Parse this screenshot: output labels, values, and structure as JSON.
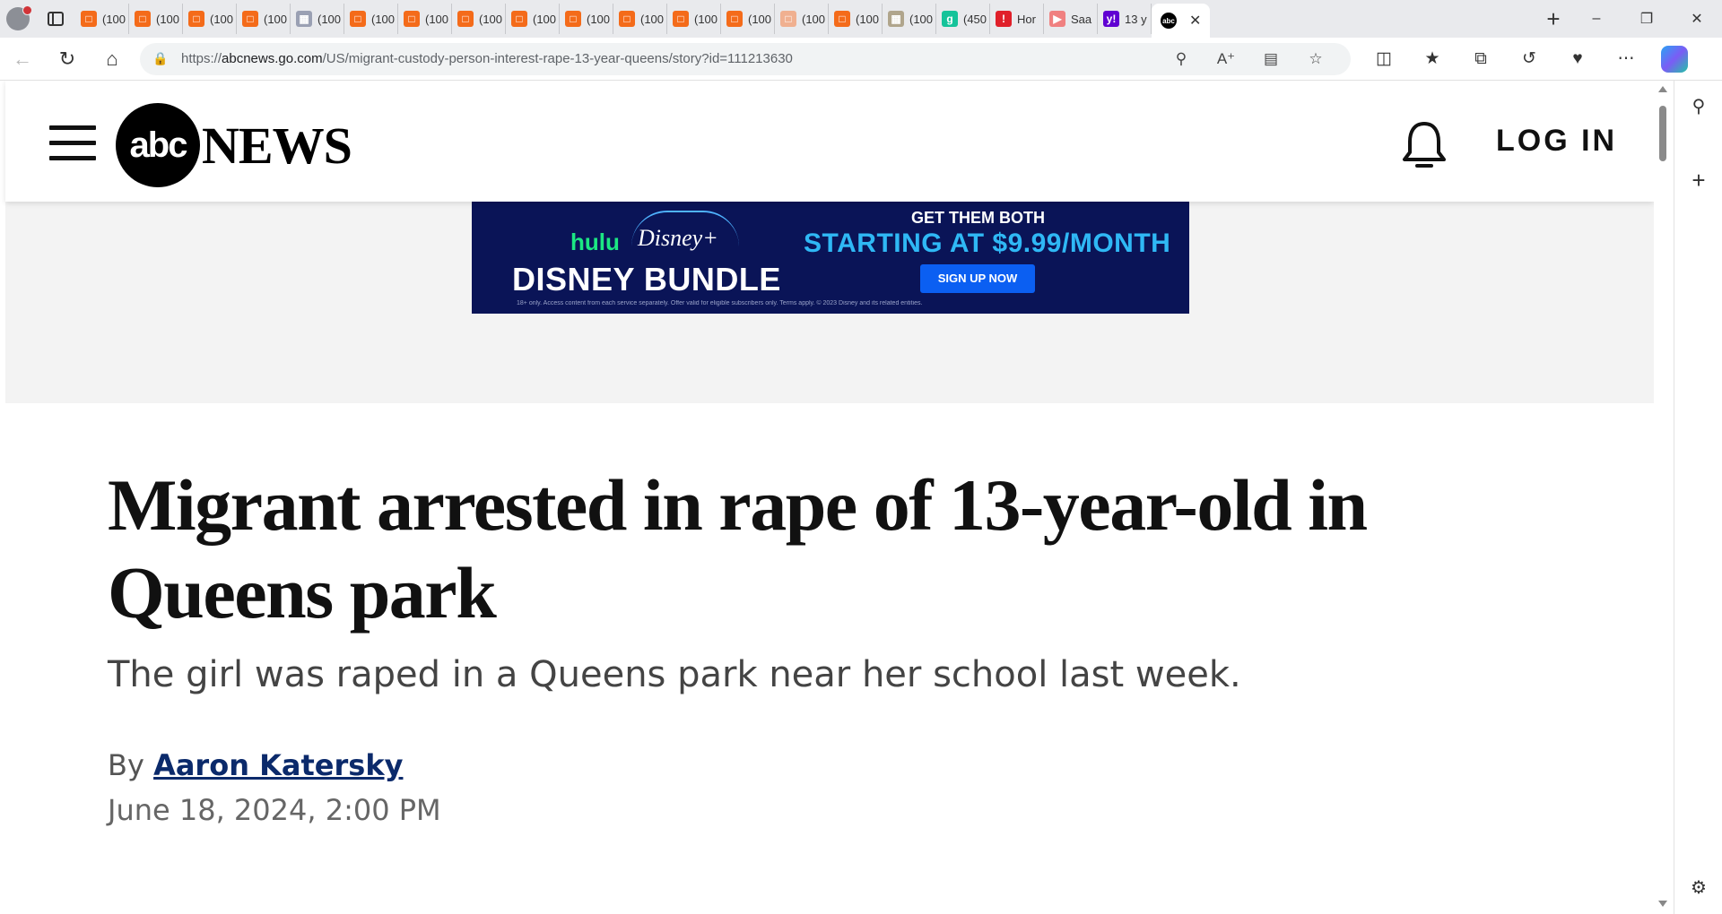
{
  "browser": {
    "tabs": [
      {
        "label": "(100",
        "icon": "reader-icon",
        "color": "#f46b1a"
      },
      {
        "label": "(100",
        "icon": "reader-icon",
        "color": "#f46b1a"
      },
      {
        "label": "(100",
        "icon": "reader-icon",
        "color": "#f46b1a"
      },
      {
        "label": "(100",
        "icon": "reader-icon",
        "color": "#f46b1a"
      },
      {
        "label": "(100",
        "icon": "image-icon",
        "color": "#9aa0b3"
      },
      {
        "label": "(100",
        "icon": "reader-icon",
        "color": "#f46b1a"
      },
      {
        "label": "(100",
        "icon": "reader-icon",
        "color": "#f46b1a"
      },
      {
        "label": "(100",
        "icon": "reader-icon",
        "color": "#f46b1a"
      },
      {
        "label": "(100",
        "icon": "reader-icon",
        "color": "#f46b1a"
      },
      {
        "label": "(100",
        "icon": "reader-icon",
        "color": "#f46b1a"
      },
      {
        "label": "(100",
        "icon": "reader-icon",
        "color": "#f46b1a"
      },
      {
        "label": "(100",
        "icon": "reader-icon",
        "color": "#f46b1a"
      },
      {
        "label": "(100",
        "icon": "reader-icon",
        "color": "#f46b1a"
      },
      {
        "label": "(100",
        "icon": "reader-icon",
        "color": "#f0b090"
      },
      {
        "label": "(100",
        "icon": "reader-icon",
        "color": "#f46b1a"
      },
      {
        "label": "(100",
        "icon": "image-icon",
        "color": "#b0a58c"
      },
      {
        "label": "(450",
        "icon": "grammarly-icon",
        "color": "#15c39a"
      },
      {
        "label": "Hor",
        "icon": "alert-icon",
        "color": "#e0202a"
      },
      {
        "label": "Saa",
        "icon": "youtube-icon",
        "color": "#f08080"
      },
      {
        "label": "13 y",
        "icon": "yahoo-icon",
        "color": "#6001d2"
      }
    ],
    "active_tab": {
      "label": "abc",
      "icon": "abc-icon"
    },
    "url_prefix": "https://",
    "url_domain": "abcnews.go.com",
    "url_path": "/US/migrant-custody-person-interest-rape-13-year-queens/story?id=111213630"
  },
  "site": {
    "logo_abc": "abc",
    "logo_news": "NEWS",
    "login_label": "LOG IN"
  },
  "ad": {
    "hulu": "hulu",
    "disney": "Disney+",
    "bundle": "DISNEY BUNDLE",
    "both": "GET THEM BOTH",
    "price": "STARTING AT $9.99/MONTH",
    "signup": "SIGN UP NOW",
    "fine": "18+ only. Access content from each service separately. Offer valid for eligible subscribers only. Terms apply. © 2023 Disney and its related entities."
  },
  "article": {
    "headline": "Migrant arrested in rape of 13-year-old in Queens park",
    "subhead": "The girl was raped in a Queens park near her school last week.",
    "by": "By",
    "author": "Aaron Katersky",
    "date": "June 18, 2024, 2:00 PM"
  }
}
